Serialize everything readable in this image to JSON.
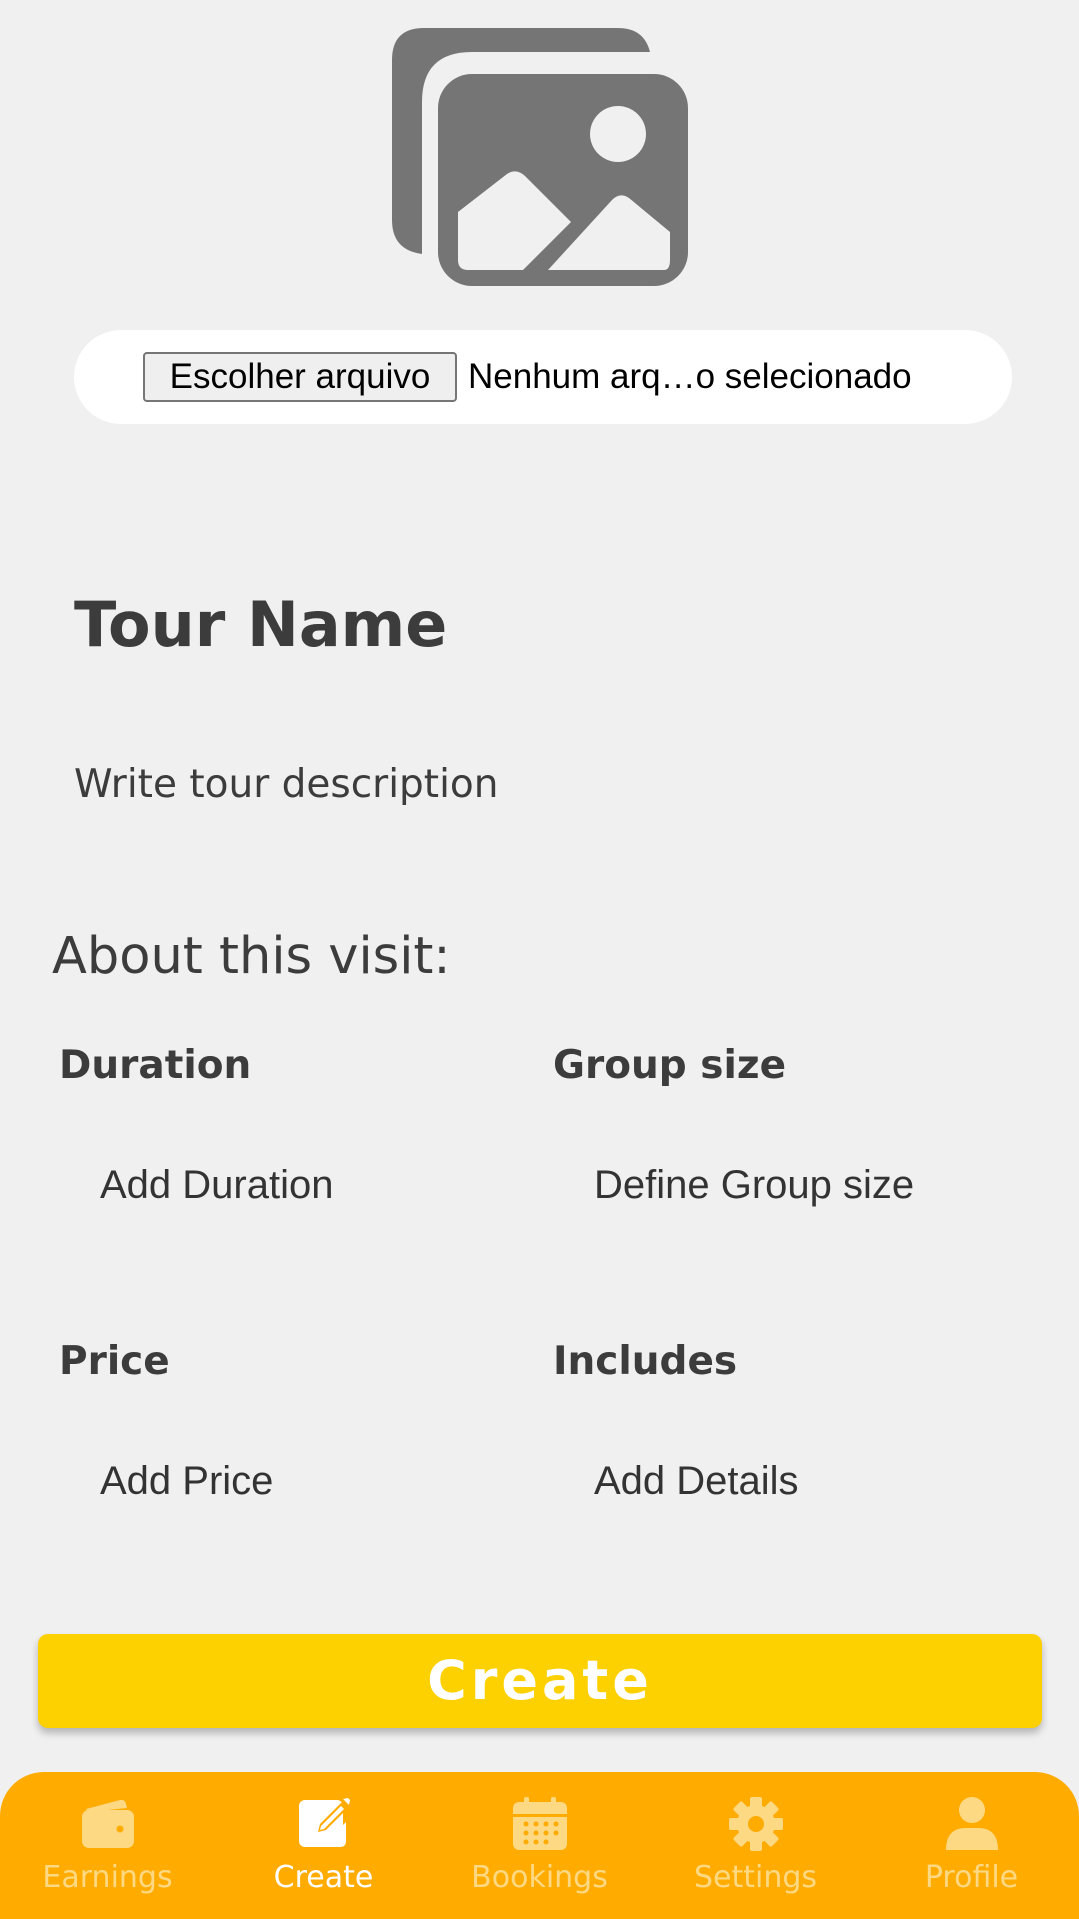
{
  "upload": {
    "icon": "images-icon",
    "button_label": "Escolher arquivo",
    "status_text": "Nenhum arq…o selecionado"
  },
  "tour": {
    "name": "Tour Name",
    "description_placeholder": "Write tour description"
  },
  "about": {
    "title": "About this visit:",
    "fields": {
      "duration": {
        "label": "Duration",
        "placeholder": "Add Duration"
      },
      "group_size": {
        "label": "Group size",
        "placeholder": "Define Group size"
      },
      "price": {
        "label": "Price",
        "placeholder": "Add Price"
      },
      "includes": {
        "label": "Includes",
        "placeholder": "Add Details"
      }
    }
  },
  "create_button": {
    "label": "Create"
  },
  "nav": {
    "items": [
      {
        "label": "Earnings",
        "icon": "wallet-icon",
        "active": false
      },
      {
        "label": "Create",
        "icon": "edit-icon",
        "active": true
      },
      {
        "label": "Bookings",
        "icon": "calendar-icon",
        "active": false
      },
      {
        "label": "Settings",
        "icon": "gear-icon",
        "active": false
      },
      {
        "label": "Profile",
        "icon": "user-icon",
        "active": false
      }
    ]
  },
  "colors": {
    "background": "#f0f0f0",
    "accent_yellow": "#fdd000",
    "nav_background": "#ffab00",
    "nav_inactive": "#fdd983",
    "nav_active": "#ffffff",
    "text": "#3c3c3c",
    "icon_gray": "#757575"
  }
}
